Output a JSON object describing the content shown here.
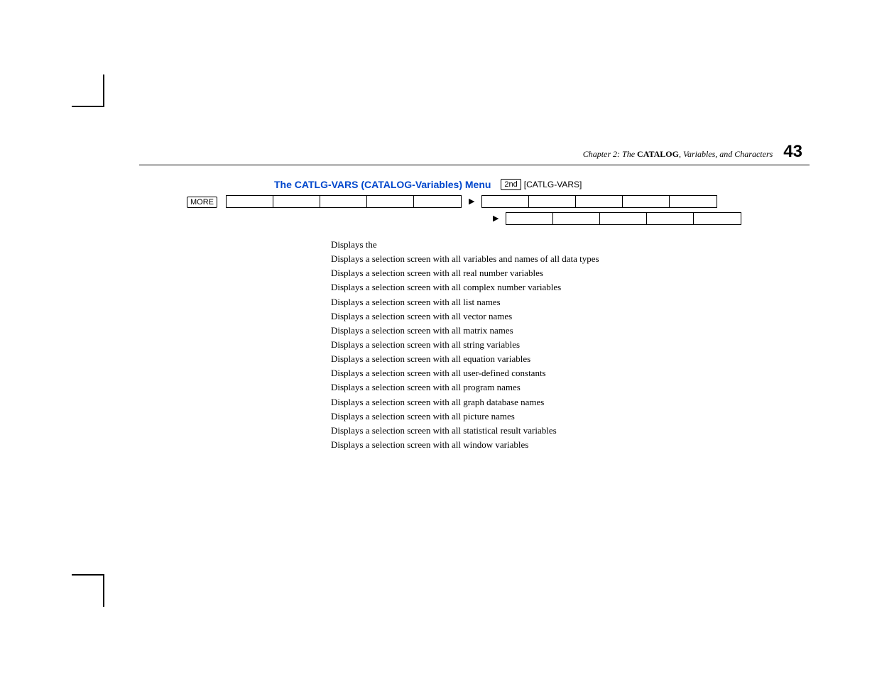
{
  "header": {
    "chapter_prefix": "Chapter 2: The ",
    "chapter_bold": "CATALOG",
    "chapter_suffix": ", Variables, and Characters",
    "page_number": "43"
  },
  "section": {
    "title": "The CATLG-VARS (CATALOG-Variables) Menu",
    "key_2nd": "2nd",
    "bracket_label": "[CATLG-VARS]"
  },
  "more_key": "MORE",
  "descriptions": [
    "Displays the",
    "Displays a selection screen with all variables and names of all data types",
    "Displays a selection screen with all real number variables",
    "Displays a selection screen with all complex number variables",
    "Displays a selection screen with all list names",
    "Displays a selection screen with all vector names",
    "Displays a selection screen with all matrix names",
    "Displays a selection screen with all string variables",
    "Displays a selection screen with all equation variables",
    "Displays a selection screen with all user-defined constants",
    "Displays a selection screen with all program names",
    "Displays a selection screen with all graph database names",
    "Displays a selection screen with all picture names",
    "Displays a selection screen with all statistical result variables",
    "Displays a selection screen with all window variables"
  ]
}
